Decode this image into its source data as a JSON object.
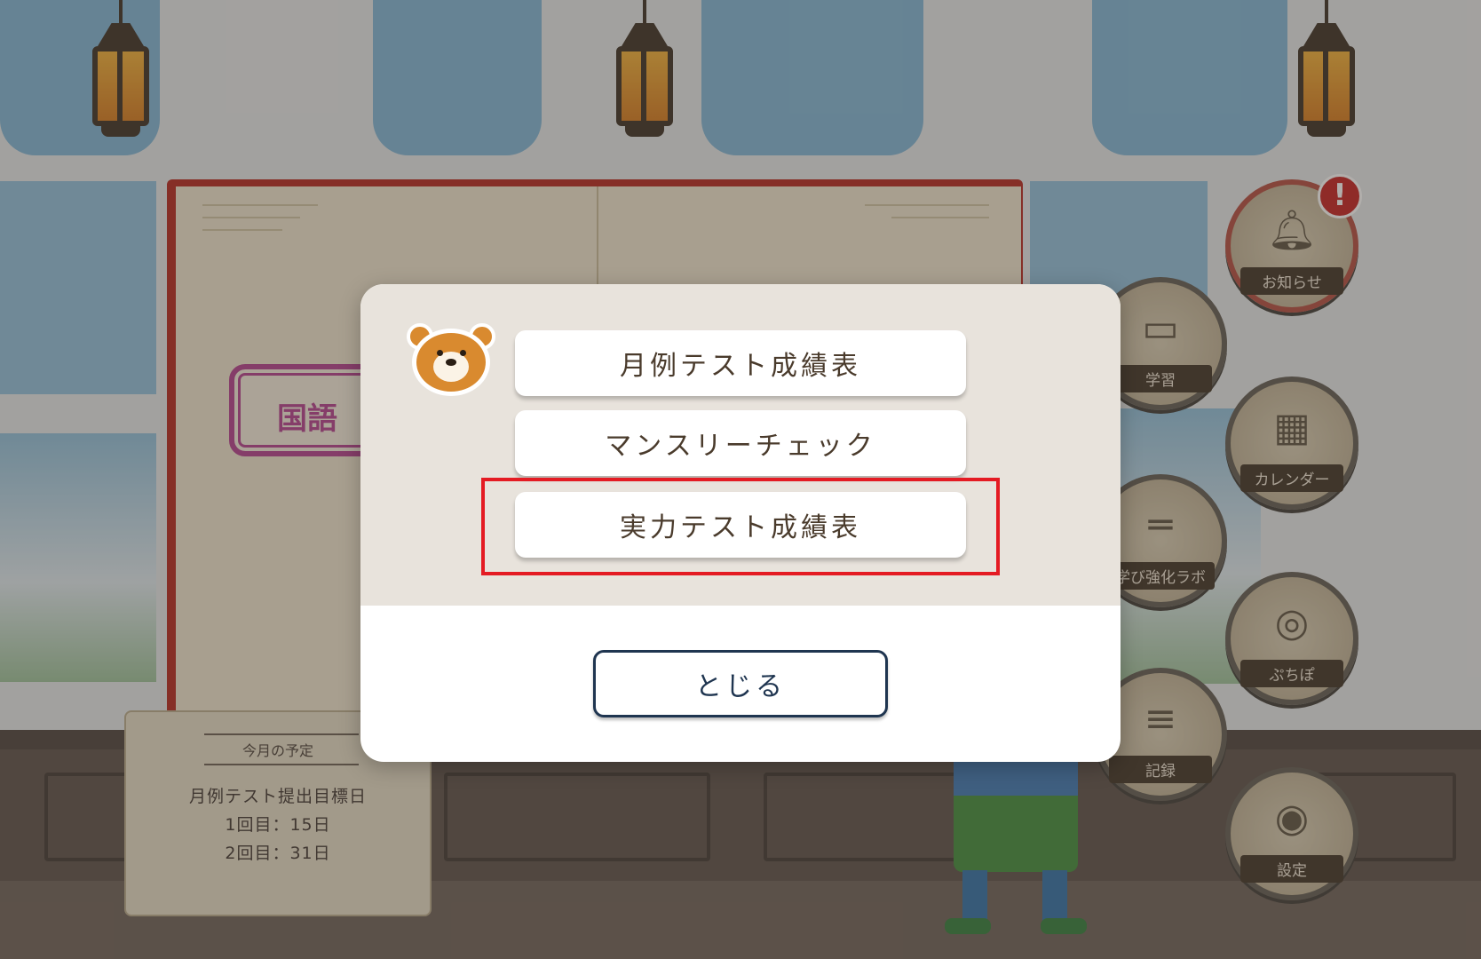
{
  "menu": {
    "items": [
      {
        "label": "月例テスト成績表"
      },
      {
        "label": "マンスリーチェック"
      },
      {
        "label": "実力テスト成績表"
      }
    ],
    "close_label": "とじる"
  },
  "book": {
    "subject_tag": "国語"
  },
  "schedule": {
    "title": "今月の予定",
    "lines": [
      "月例テスト提出目標日",
      "1回目：15日",
      "2回目：31日"
    ]
  },
  "side_nav": {
    "items": [
      {
        "label": "お知らせ",
        "icon": "bell-icon",
        "has_alert": true
      },
      {
        "label": "学習",
        "icon": "tablet-pen-icon"
      },
      {
        "label": "カレンダー",
        "icon": "calendar-icon"
      },
      {
        "label": "学び強化ラボ",
        "icon": "dumbbell-icon"
      },
      {
        "label": "ぷちぽ",
        "icon": "binoculars-hat-icon"
      },
      {
        "label": "記録",
        "icon": "bar-chart-icon"
      },
      {
        "label": "設定",
        "icon": "bear-icon"
      }
    ],
    "alert_mark": "!"
  },
  "colors": {
    "highlight_border": "#e41b23",
    "close_button_border": "#1f3550",
    "modal_top_bg": "#e8e3dc",
    "alert_red": "#c41e1e"
  }
}
